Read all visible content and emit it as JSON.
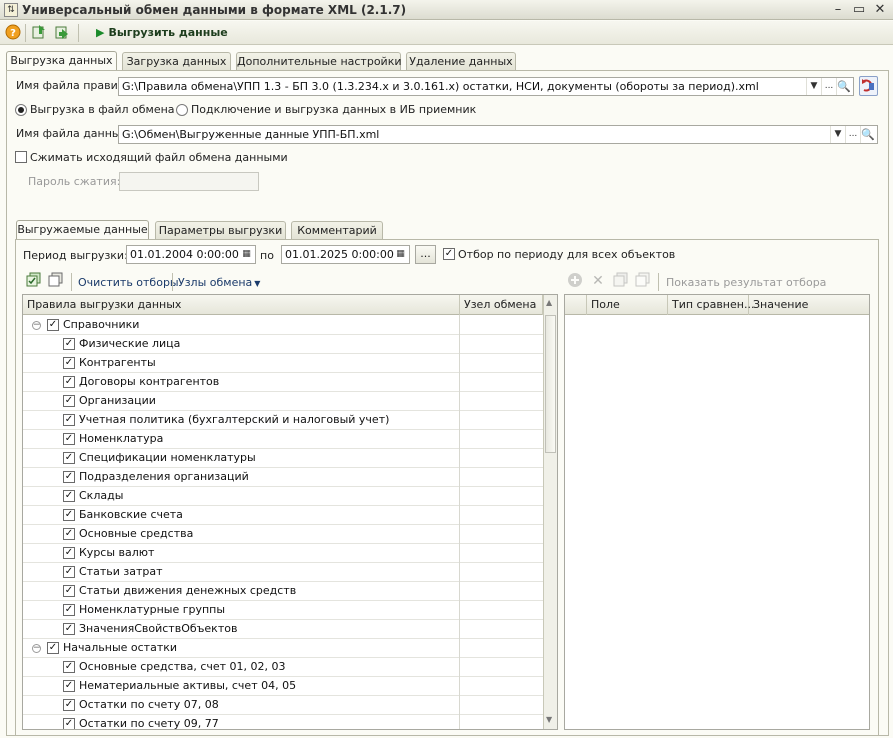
{
  "window": {
    "title": "Универсальный обмен данными в формате XML (2.1.7)",
    "minimize": "–",
    "restore": "▭",
    "close": "✕"
  },
  "toolbar": {
    "export_label": "Выгрузить данные"
  },
  "main_tabs": [
    {
      "label": "Выгрузка данных"
    },
    {
      "label": "Загрузка данных"
    },
    {
      "label": "Дополнительные настройки"
    },
    {
      "label": "Удаление данных"
    }
  ],
  "rules_file": {
    "label": "Имя файла правил:",
    "value": "G:\\Правила обмена\\УПП 1.3 - БП 3.0 (1.3.234.x и 3.0.161.x) остатки, НСИ, документы (обороты за период).xml"
  },
  "mode": {
    "option_file": "Выгрузка в файл обмена",
    "option_db": "Подключение и выгрузка данных в ИБ приемник"
  },
  "data_file": {
    "label": "Имя файла данных:",
    "value": "G:\\Обмен\\Выгруженные данные УПП-БП.xml"
  },
  "compress": {
    "label": "Сжимать исходящий файл обмена данными"
  },
  "password": {
    "label": "Пароль сжатия:",
    "value": ""
  },
  "inner_tabs": [
    {
      "label": "Выгружаемые данные"
    },
    {
      "label": "Параметры выгрузки"
    },
    {
      "label": "Комментарий"
    }
  ],
  "period": {
    "label": "Период выгрузки:",
    "from": "01.01.2004  0:00:00",
    "to_label": "по",
    "to": "01.01.2025  0:00:00",
    "more": "...",
    "filter_all_label": "Отбор по периоду для всех объектов"
  },
  "rules_toolbar": {
    "clear_filters": "Очистить отборы",
    "exchange_nodes": "Узлы обмена"
  },
  "rules_grid": {
    "col_rules": "Правила выгрузки данных",
    "col_node": "Узел обмена",
    "rows": [
      {
        "text": "Справочники",
        "group": true
      },
      {
        "text": "Физические лица"
      },
      {
        "text": "Контрагенты"
      },
      {
        "text": "Договоры контрагентов"
      },
      {
        "text": "Организации"
      },
      {
        "text": "Учетная политика (бухгалтерский и налоговый учет)"
      },
      {
        "text": "Номенклатура"
      },
      {
        "text": "Спецификации номенклатуры"
      },
      {
        "text": "Подразделения организаций"
      },
      {
        "text": "Склады"
      },
      {
        "text": "Банковские счета"
      },
      {
        "text": "Основные средства"
      },
      {
        "text": "Курсы валют"
      },
      {
        "text": "Статьи затрат"
      },
      {
        "text": "Статьи движения денежных средств"
      },
      {
        "text": "Номенклатурные группы"
      },
      {
        "text": "ЗначенияСвойствОбъектов"
      },
      {
        "text": "Начальные остатки",
        "group": true
      },
      {
        "text": "Основные средства, счет 01, 02, 03"
      },
      {
        "text": "Нематериальные активы, счет 04, 05"
      },
      {
        "text": "Остатки по счету 07, 08"
      },
      {
        "text": "Остатки по счету 09, 77"
      }
    ]
  },
  "filter_toolbar": {
    "show_result": "Показать результат отбора"
  },
  "filter_grid": {
    "col_field": "Поле",
    "col_compare": "Тип сравнен...",
    "col_value": "Значение"
  }
}
